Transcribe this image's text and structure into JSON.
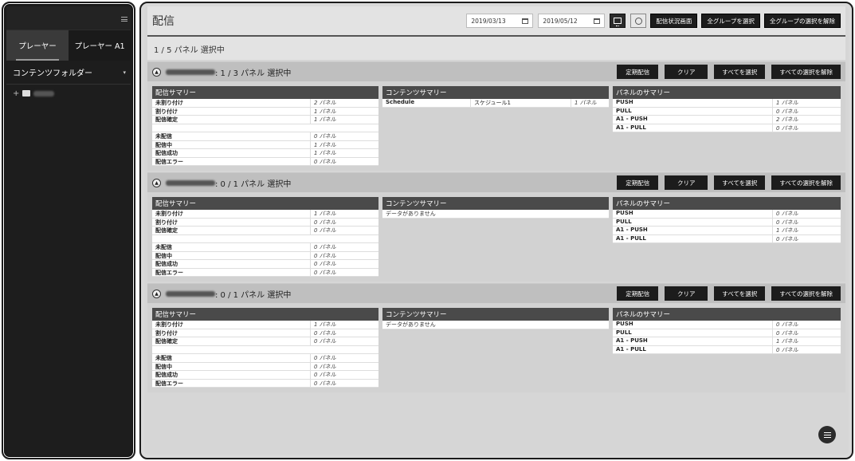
{
  "sidebar": {
    "tabs": [
      {
        "label": "プレーヤー",
        "active": true
      },
      {
        "label": "プレーヤー A1",
        "active": false
      }
    ],
    "folder_header": "コンテンツフォルダー",
    "tree_expand": "+"
  },
  "header": {
    "title": "配信",
    "date_from": "2019/03/13",
    "date_to": "2019/05/12",
    "buttons": {
      "status_screen": "配信状況画面",
      "select_all_groups": "全グループを選択",
      "deselect_all_groups": "全グループの選択を解除"
    }
  },
  "selected_count": "1 / 5 パネル 選択中",
  "group_buttons": {
    "scheduled": "定期配信",
    "clear": "クリア",
    "select_all": "すべてを選択",
    "deselect_all": "すべての選択を解除"
  },
  "table_titles": {
    "summary": "配信サマリー",
    "content": "コンテンツサマリー",
    "panel": "パネルのサマリー"
  },
  "groups": [
    {
      "selection": ": 1 / 3 パネル 選択中",
      "summary_top": [
        {
          "label": "未割り付け",
          "value": "2 パネル"
        },
        {
          "label": "割り付け",
          "value": "1 パネル"
        },
        {
          "label": "配信確定",
          "value": "1 パネル"
        }
      ],
      "summary_bottom": [
        {
          "label": "未配信",
          "value": "0 パネル"
        },
        {
          "label": "配信中",
          "value": "1 パネル"
        },
        {
          "label": "配信成功",
          "value": "1 パネル"
        },
        {
          "label": "配信エラー",
          "value": "0 パネル"
        }
      ],
      "content": [
        {
          "type": "Schedule",
          "name": "スケジュール1",
          "count": "1 パネル"
        }
      ],
      "content_empty": "",
      "panel": [
        {
          "label": "PUSH",
          "value": "1 パネル"
        },
        {
          "label": "PULL",
          "value": "0 パネル"
        },
        {
          "label": "A1 - PUSH",
          "value": "2 パネル"
        },
        {
          "label": "A1 - PULL",
          "value": "0 パネル"
        }
      ]
    },
    {
      "selection": ": 0 / 1 パネル 選択中",
      "summary_top": [
        {
          "label": "未割り付け",
          "value": "1 パネル"
        },
        {
          "label": "割り付け",
          "value": "0 パネル"
        },
        {
          "label": "配信確定",
          "value": "0 パネル"
        }
      ],
      "summary_bottom": [
        {
          "label": "未配信",
          "value": "0 パネル"
        },
        {
          "label": "配信中",
          "value": "0 パネル"
        },
        {
          "label": "配信成功",
          "value": "0 パネル"
        },
        {
          "label": "配信エラー",
          "value": "0 パネル"
        }
      ],
      "content": [],
      "content_empty": "データがありません",
      "panel": [
        {
          "label": "PUSH",
          "value": "0 パネル"
        },
        {
          "label": "PULL",
          "value": "0 パネル"
        },
        {
          "label": "A1 - PUSH",
          "value": "1 パネル"
        },
        {
          "label": "A1 - PULL",
          "value": "0 パネル"
        }
      ]
    },
    {
      "selection": ": 0 / 1 パネル 選択中",
      "summary_top": [
        {
          "label": "未割り付け",
          "value": "1 パネル"
        },
        {
          "label": "割り付け",
          "value": "0 パネル"
        },
        {
          "label": "配信確定",
          "value": "0 パネル"
        }
      ],
      "summary_bottom": [
        {
          "label": "未配信",
          "value": "0 パネル"
        },
        {
          "label": "配信中",
          "value": "0 パネル"
        },
        {
          "label": "配信成功",
          "value": "0 パネル"
        },
        {
          "label": "配信エラー",
          "value": "0 パネル"
        }
      ],
      "content": [],
      "content_empty": "データがありません",
      "panel": [
        {
          "label": "PUSH",
          "value": "0 パネル"
        },
        {
          "label": "PULL",
          "value": "0 パネル"
        },
        {
          "label": "A1 - PUSH",
          "value": "1 パネル"
        },
        {
          "label": "A1 - PULL",
          "value": "0 パネル"
        }
      ]
    }
  ]
}
